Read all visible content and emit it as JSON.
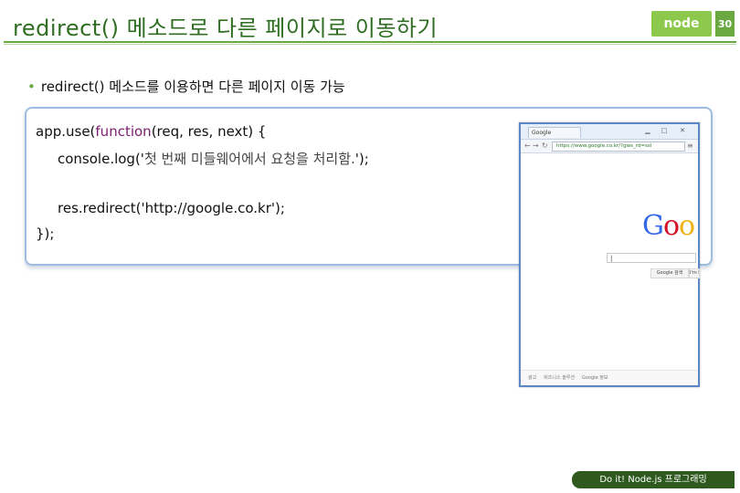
{
  "slide": {
    "title": "redirect() 메소드로 다른 페이지로 이동하기",
    "page_number": "30",
    "logo_text": "node",
    "bullet": "redirect() 메소드를 이용하면 다른 페이지 이동 가능",
    "footer": "Do it! Node.js 프로그래밍"
  },
  "code": {
    "line1_pre": "app.use(",
    "line1_kw": "function",
    "line1_post": "(req, res, next) {",
    "line2_pre": "console.log('",
    "line2_kor": "첫 번째 미들웨어에서 요청을 처리함.",
    "line2_post": "');",
    "line3": "res.redirect('http://google.co.kr');",
    "line4": "});"
  },
  "browser": {
    "tab_title": "Google",
    "url": "https://www.google.co.kr/?gws_rd=ssl",
    "logo_letters": [
      "G",
      "o",
      "o"
    ],
    "logo_colors": [
      "#3369e8",
      "#d50f25",
      "#eeb211"
    ],
    "search_value": "|",
    "button_search": "Google 검색",
    "button_lucky": "I'm Feeling Lucky",
    "footer_links": [
      "광고",
      "비즈니스 솔루션",
      "Google 정보"
    ],
    "icons": {
      "back": "back-arrow-icon",
      "forward": "forward-arrow-icon",
      "reload": "reload-icon",
      "menu": "menu-icon"
    }
  }
}
